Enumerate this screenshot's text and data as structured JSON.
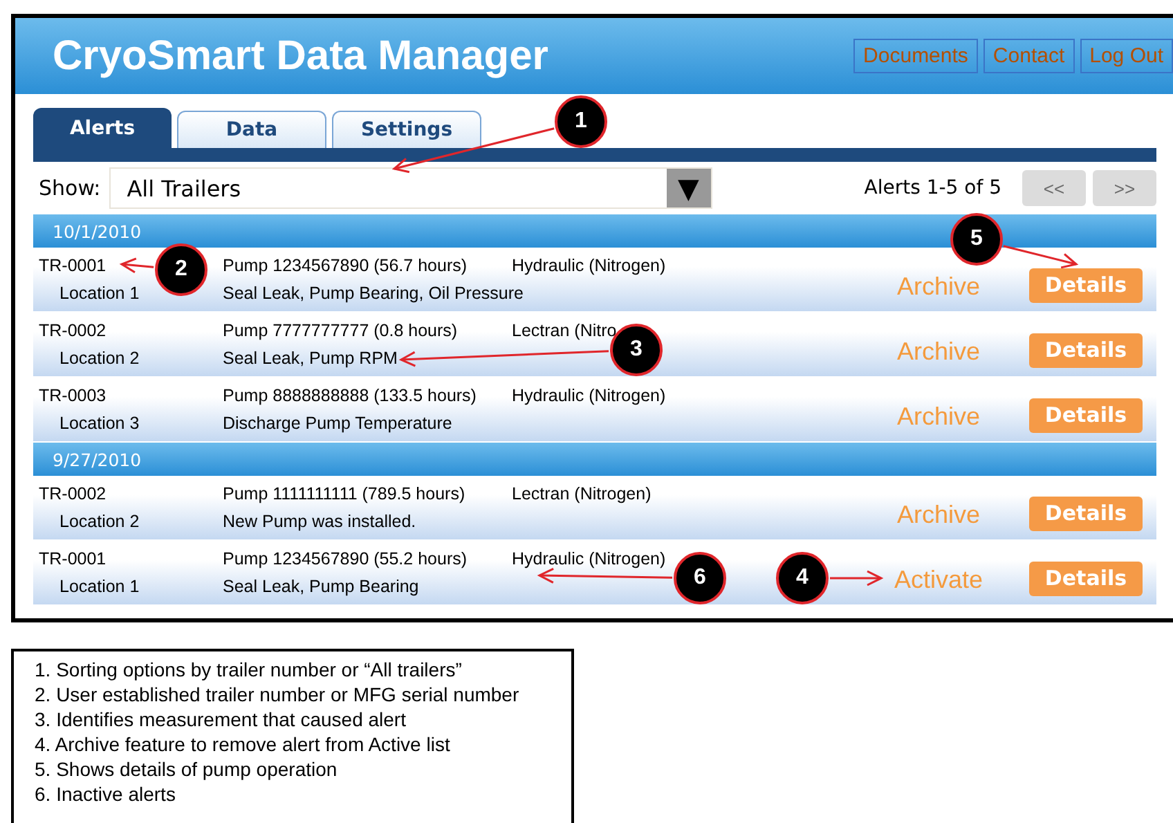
{
  "app": {
    "title": "CryoSmart Data Manager",
    "nav": [
      "Documents",
      "Contact",
      "Log Out"
    ]
  },
  "tabs": [
    {
      "label": "Alerts",
      "selected": true
    },
    {
      "label": "Data",
      "selected": false
    },
    {
      "label": "Settings",
      "selected": false
    }
  ],
  "filter": {
    "label": "Show:",
    "value": "All Trailers",
    "dropdown_glyph": "▼"
  },
  "pager": {
    "text": "Alerts 1-5 of 5",
    "prev": "<<",
    "next": ">>",
    "disabled": true
  },
  "groups": [
    {
      "date": "10/1/2010",
      "rows": [
        {
          "trailer": "TR-0001",
          "location": "Location 1",
          "pump": "Pump 1234567890 (56.7 hours)",
          "type": "Hydraulic (Nitrogen)",
          "issue": "Seal Leak, Pump Bearing, Oil Pressure",
          "action": "Archive",
          "button": "Details"
        },
        {
          "trailer": "TR-0002",
          "location": "Location 2",
          "pump": "Pump 7777777777 (0.8 hours)",
          "type": "Lectran (Nitro",
          "issue": "Seal Leak, Pump RPM",
          "action": "Archive",
          "button": "Details"
        },
        {
          "trailer": "TR-0003",
          "location": "Location 3",
          "pump": "Pump 8888888888 (133.5 hours)",
          "type": "Hydraulic (Nitrogen)",
          "issue": "Discharge Pump Temperature",
          "action": "Archive",
          "button": "Details"
        }
      ]
    },
    {
      "date": "9/27/2010",
      "rows": [
        {
          "trailer": "TR-0002",
          "location": "Location 2",
          "pump": "Pump 1111111111 (789.5 hours)",
          "type": "Lectran (Nitrogen)",
          "issue": "New Pump was installed.",
          "action": "Archive",
          "button": "Details"
        },
        {
          "trailer": "TR-0001",
          "location": "Location 1",
          "pump": "Pump 1234567890 (55.2 hours)",
          "type": "Hydraulic (Nitrogen)",
          "issue": "Seal Leak, Pump Bearing",
          "action": "Activate",
          "button": "Details"
        }
      ]
    }
  ],
  "callouts": [
    {
      "number": "1"
    },
    {
      "number": "2"
    },
    {
      "number": "3"
    },
    {
      "number": "4"
    },
    {
      "number": "5"
    },
    {
      "number": "6"
    }
  ],
  "legend": [
    "1. Sorting options by trailer number or “All trailers”",
    "2. User established trailer number or MFG serial number",
    "3. Identifies measurement that caused alert",
    "4. Archive feature to remove alert from Active list",
    "5. Shows details of pump operation",
    "6. Inactive alerts"
  ]
}
